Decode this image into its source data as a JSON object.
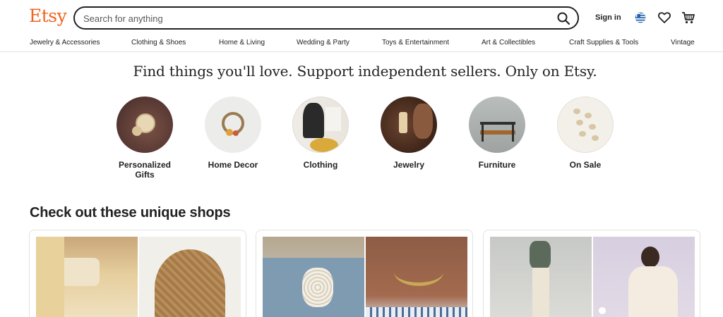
{
  "header": {
    "logo": "Etsy",
    "search_placeholder": "Search for anything",
    "signin_label": "Sign in",
    "icons": [
      "search-icon",
      "globe-flag-icon",
      "heart-icon",
      "cart-icon"
    ],
    "brand_color": "#f1641e"
  },
  "nav": {
    "items": [
      {
        "label": "Jewelry & Accessories"
      },
      {
        "label": "Clothing & Shoes"
      },
      {
        "label": "Home & Living"
      },
      {
        "label": "Wedding & Party"
      },
      {
        "label": "Toys & Entertainment"
      },
      {
        "label": "Art & Collectibles"
      },
      {
        "label": "Craft Supplies & Tools"
      },
      {
        "label": "Vintage"
      }
    ]
  },
  "hero": {
    "title": "Find things you'll love. Support independent sellers. Only on Etsy."
  },
  "categories": [
    {
      "label": "Personalized Gifts"
    },
    {
      "label": "Home Decor"
    },
    {
      "label": "Clothing"
    },
    {
      "label": "Jewelry"
    },
    {
      "label": "Furniture"
    },
    {
      "label": "On Sale"
    }
  ],
  "shops": {
    "title": "Check out these unique shops"
  }
}
